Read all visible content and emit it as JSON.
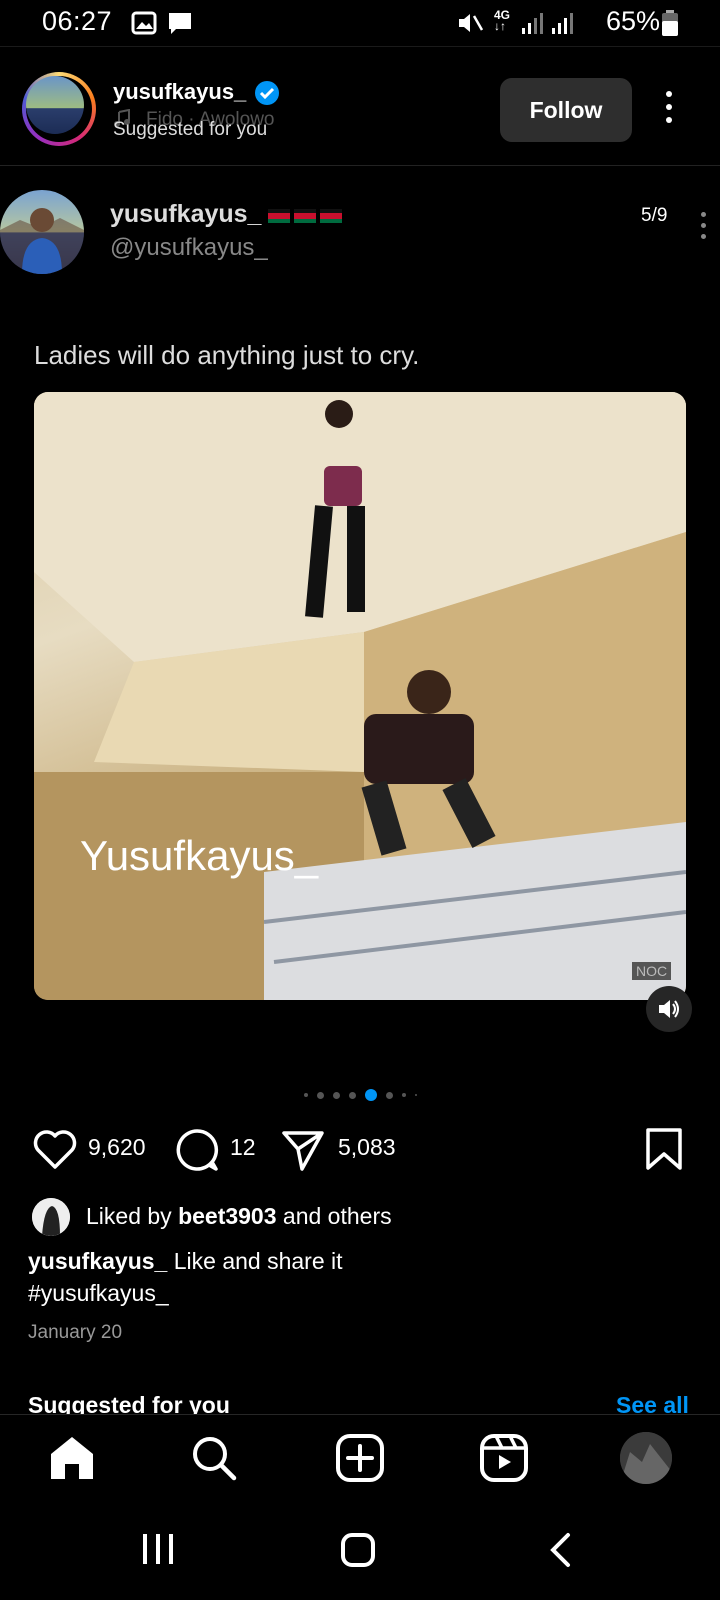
{
  "status_bar": {
    "time": "06:27",
    "battery_percent": "65%"
  },
  "header": {
    "username": "yusufkayus_",
    "music": "Fido · Awolowo",
    "subtitle": "Suggested for you",
    "follow_label": "Follow"
  },
  "post": {
    "display_name": "yusufkayus_",
    "handle": "@yusufkayus_",
    "slide_counter": "5/9",
    "text": "Ladies will do anything just to cry.",
    "watermark": "Yusufkayus_",
    "corner_tag": "NOC",
    "carousel": {
      "total": 9,
      "active_index": 4
    }
  },
  "actions": {
    "likes": "9,620",
    "comments": "12",
    "shares": "5,083"
  },
  "liked_by": {
    "prefix": "Liked by ",
    "user": "beet3903",
    "suffix": " and others"
  },
  "caption": {
    "username": "yusufkayus_",
    "text": " Like and share it",
    "hashtag": "#yusufkayus_"
  },
  "date": "January 20",
  "suggested": {
    "title": "Suggested for you",
    "see_all": "See all"
  },
  "colors": {
    "accent": "#0095f6",
    "follow_bg": "#2e2e2e",
    "bg": "#000000"
  }
}
